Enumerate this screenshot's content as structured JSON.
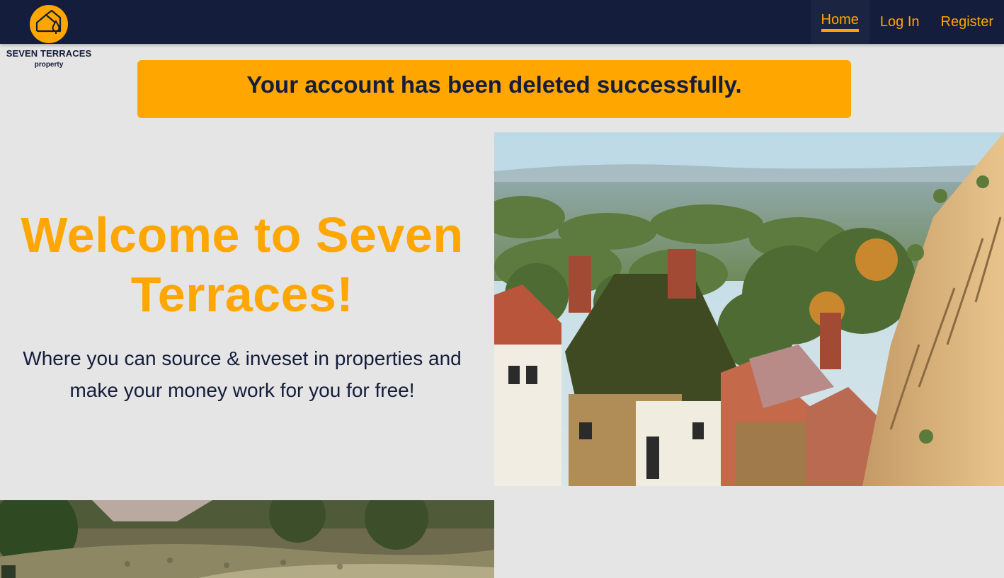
{
  "brand": {
    "name": "SEVEN TERRACES",
    "tagline": "property",
    "icon": "house-drop-icon",
    "accent": "#ffa600",
    "navy": "#141d3b"
  },
  "nav": {
    "items": [
      {
        "label": "Home",
        "active": true
      },
      {
        "label": "Log In",
        "active": false
      },
      {
        "label": "Register",
        "active": false
      }
    ]
  },
  "alert": {
    "message": "Your account has been deleted successfully."
  },
  "hero": {
    "title_line1": "Welcome to Seven",
    "title_line2": "Terraces!",
    "subtitle_line1": "Where you can source & inveset in properties and",
    "subtitle_line2": "make your money work for you for free!"
  }
}
